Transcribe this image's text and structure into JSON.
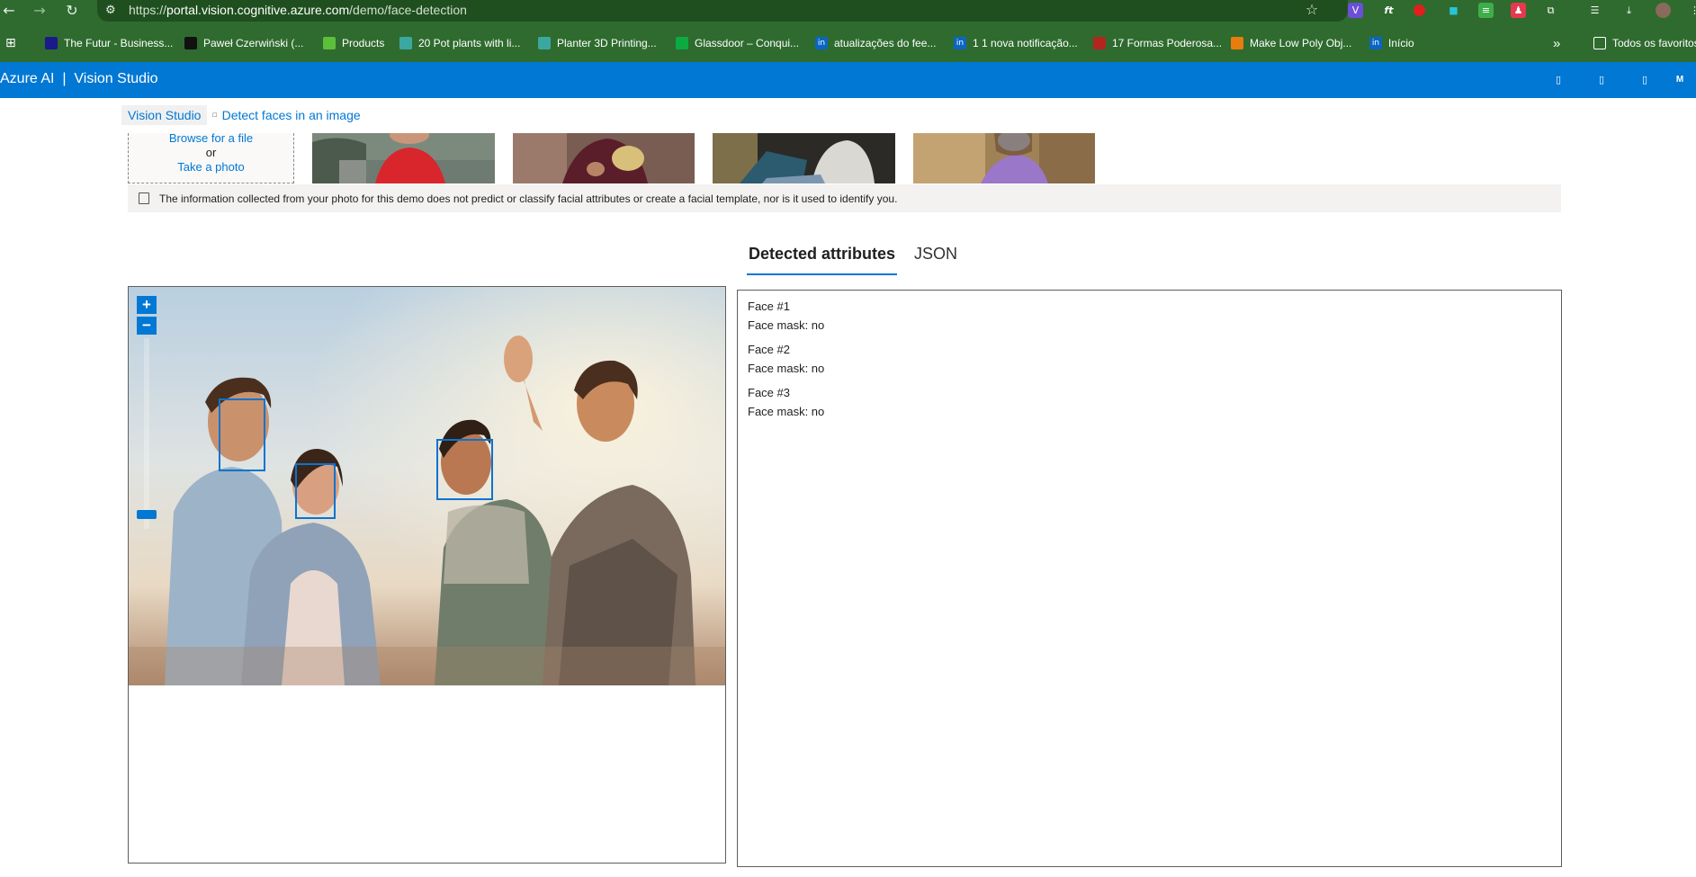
{
  "browser": {
    "url_prefix": "https://",
    "url_host": "portal.vision.cognitive.azure.com",
    "url_path": "/demo/face-detection",
    "icons": {
      "back": "back-arrow-icon",
      "forward": "forward-arrow-icon",
      "reload": "reload-icon",
      "site": "site-settings-icon",
      "star": "bookmark-star-icon"
    },
    "bookmarks": [
      {
        "label": "The Futur - Business...",
        "icon": "futur-icon",
        "color": "#1a1a8a"
      },
      {
        "label": "Paweł Czerwiński (...",
        "icon": "unsplash-icon",
        "color": "#111111"
      },
      {
        "label": "Products",
        "icon": "products-icon",
        "color": "#5bbf3a"
      },
      {
        "label": "20 Pot plants with li...",
        "icon": "qr-icon",
        "color": "#3aa8a0"
      },
      {
        "label": "Planter 3D Printing...",
        "icon": "qr-icon",
        "color": "#3aa8a0"
      },
      {
        "label": "Glassdoor – Conqui...",
        "icon": "glassdoor-icon",
        "color": "#0caa41"
      },
      {
        "label": "atualizações do fee...",
        "icon": "linkedin-icon",
        "color": "#0a66c2"
      },
      {
        "label": "1 1 nova notificação...",
        "icon": "linkedin-icon",
        "color": "#0a66c2"
      },
      {
        "label": "17 Formas Poderosa...",
        "icon": "bookmark-red-icon",
        "color": "#b3261e"
      },
      {
        "label": "Make Low Poly Obj...",
        "icon": "blender-icon",
        "color": "#e87d0d"
      },
      {
        "label": "Início",
        "icon": "linkedin-icon",
        "color": "#0a66c2"
      }
    ],
    "more_bookmarks": "»",
    "other_folder": "Todos os favoritos"
  },
  "app": {
    "title": "Azure AI  |  Vision Studio",
    "header_avatar": "M"
  },
  "breadcrumb": {
    "home": "Vision Studio",
    "current": "Detect faces in an image"
  },
  "upload": {
    "browse": "Browse for a file",
    "or": "or",
    "photo": "Take a photo"
  },
  "notice": {
    "text": "The information collected from your photo for this demo does not predict or classify facial attributes or create a facial template, nor is it used to identify you."
  },
  "tabs": {
    "detected": "Detected attributes",
    "json": "JSON"
  },
  "zoom": {
    "in": "+",
    "out": "−"
  },
  "faces": [
    {
      "title": "Face #1",
      "attribute": "Face mask: no"
    },
    {
      "title": "Face #2",
      "attribute": "Face mask: no"
    },
    {
      "title": "Face #3",
      "attribute": "Face mask: no"
    }
  ],
  "colors": {
    "accent": "#0078d4",
    "browser_bg": "#2f6b2f"
  }
}
